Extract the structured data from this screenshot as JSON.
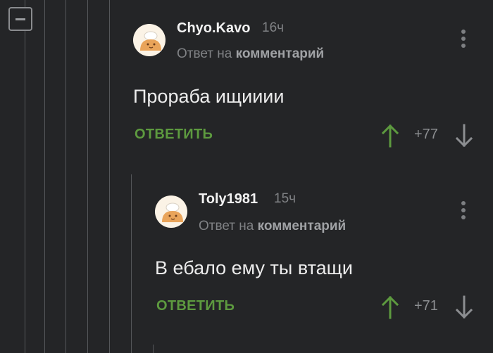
{
  "thread": {
    "collapse_icon": "minus-square-icon"
  },
  "comments": [
    {
      "username": "Chyo.Kavo",
      "time": "16ч",
      "reply_prefix": "Ответ на",
      "reply_link": "комментарий",
      "text": "Прораба ищииии",
      "reply_label": "ОТВЕТИТЬ",
      "score": "+77",
      "avatar_icon": "chef-avatar-icon"
    },
    {
      "username": "Toly1981",
      "time": "15ч",
      "reply_prefix": "Ответ на",
      "reply_link": "комментарий",
      "text": "В ебало ему ты втащи",
      "reply_label": "ОТВЕТИТЬ",
      "score": "+71",
      "avatar_icon": "chef-avatar-icon"
    }
  ],
  "colors": {
    "background": "#242527",
    "upvote": "#5d9a3f",
    "reply_button": "#5d9a3f",
    "muted": "#808285"
  }
}
